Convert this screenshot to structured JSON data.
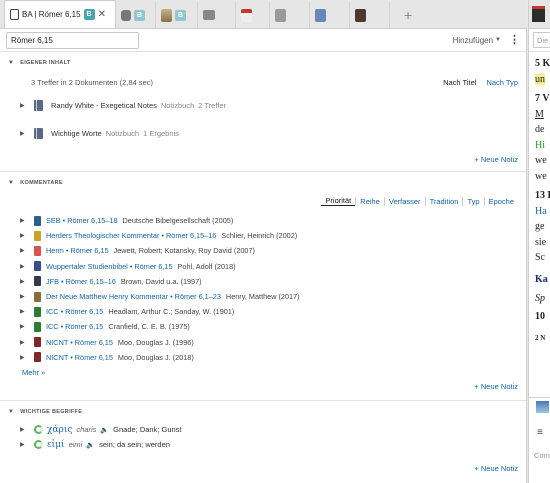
{
  "tabs": {
    "active_title": "BA | Römer 6,15",
    "active_badge": "B",
    "others": [
      {
        "badge": ""
      },
      {
        "badge": "B"
      },
      {
        "badge": "B"
      },
      {
        "badge": ""
      },
      {
        "badge": ""
      },
      {
        "badge": ""
      },
      {
        "badge": ""
      },
      {
        "badge": ""
      }
    ]
  },
  "search": {
    "value": "Römer 6,15",
    "add_label": "Hinzufügen"
  },
  "eigener_inhalt": {
    "title": "EIGENER INHALT",
    "summary": "3 Treffer in 2 Dokumenten (2,84 sec)",
    "sort_title": "Nach Titel",
    "sort_type": "Nach Typ",
    "items": [
      {
        "name": "Randy White - Exegetical Notes",
        "type": "Notizbuch",
        "count": "2 Treffer"
      },
      {
        "name": "Wichtige Worte",
        "type": "Notizbuch",
        "count": "1 Ergebnis"
      }
    ],
    "new_note": "+ Neue Notiz"
  },
  "kommentare": {
    "title": "KOMMENTARE",
    "filters": [
      "Priorität",
      "Reihe",
      "Verfasser",
      "Tradition",
      "Typ",
      "Epoche"
    ],
    "items": [
      {
        "link": "SEB • Römer 6,15–18",
        "rest": "Deutsche Bibelgesellschaft (2005)",
        "color": "#2a5f8f"
      },
      {
        "link": "Herders Theologischer Kommentar • Römer 6,15–16",
        "rest": "Schlier, Heinrich (2002)",
        "color": "#c9a227"
      },
      {
        "link": "Herm • Römer 6,15",
        "rest": "Jewett, Robert; Kotansky, Roy David (2007)",
        "color": "#d9534f"
      },
      {
        "link": "Wuppertaler Studienbibel • Römer 6,15",
        "rest": "Pohl, Adolf (2018)",
        "color": "#3b4e8c"
      },
      {
        "link": "JFB • Römer 6,15–16",
        "rest": "Brown, David u.a. (1997)",
        "color": "#333a4a"
      },
      {
        "link": "Der Neue Matthew Henry Kommentar • Römer 6,1–23",
        "rest": "Henry, Matthew (2017)",
        "color": "#8a6d3b"
      },
      {
        "link": "ICC • Römer 6,15",
        "rest": "Headlam, Arthur C.; Sanday, W. (1901)",
        "color": "#2e7d32"
      },
      {
        "link": "ICC • Römer 6,15",
        "rest": "Cranfield, C. E. B. (1975)",
        "color": "#2e7d32"
      },
      {
        "link": "NICNT • Römer 6,15",
        "rest": "Moo, Douglas J. (1996)",
        "color": "#7a2a2a"
      },
      {
        "link": "NICNT • Römer 6,15",
        "rest": "Moo, Douglas J. (2018)",
        "color": "#7a2a2a"
      }
    ],
    "more": "Mehr »",
    "new_note": "+ Neue Notiz"
  },
  "begriffe": {
    "title": "WICHTIGE BEGRIFFE",
    "items": [
      {
        "greek": "χάρις",
        "translit": "charis",
        "meaning": "Gnade; Dank; Gunst"
      },
      {
        "greek": "εἰμί",
        "translit": "eimi",
        "meaning": "sein; da sein; werden"
      }
    ],
    "new_note": "+ Neue Notiz"
  },
  "right_panel": {
    "input_placeholder": "Die S",
    "lines": [
      "5 K",
      "un",
      "7 V",
      "M",
      "de",
      "Hi",
      "we",
      "we",
      "13 F",
      "Ha",
      "ge",
      "sie",
      "Sc",
      "Ka",
      "Sp",
      "10",
      "2 N",
      "Com"
    ]
  }
}
